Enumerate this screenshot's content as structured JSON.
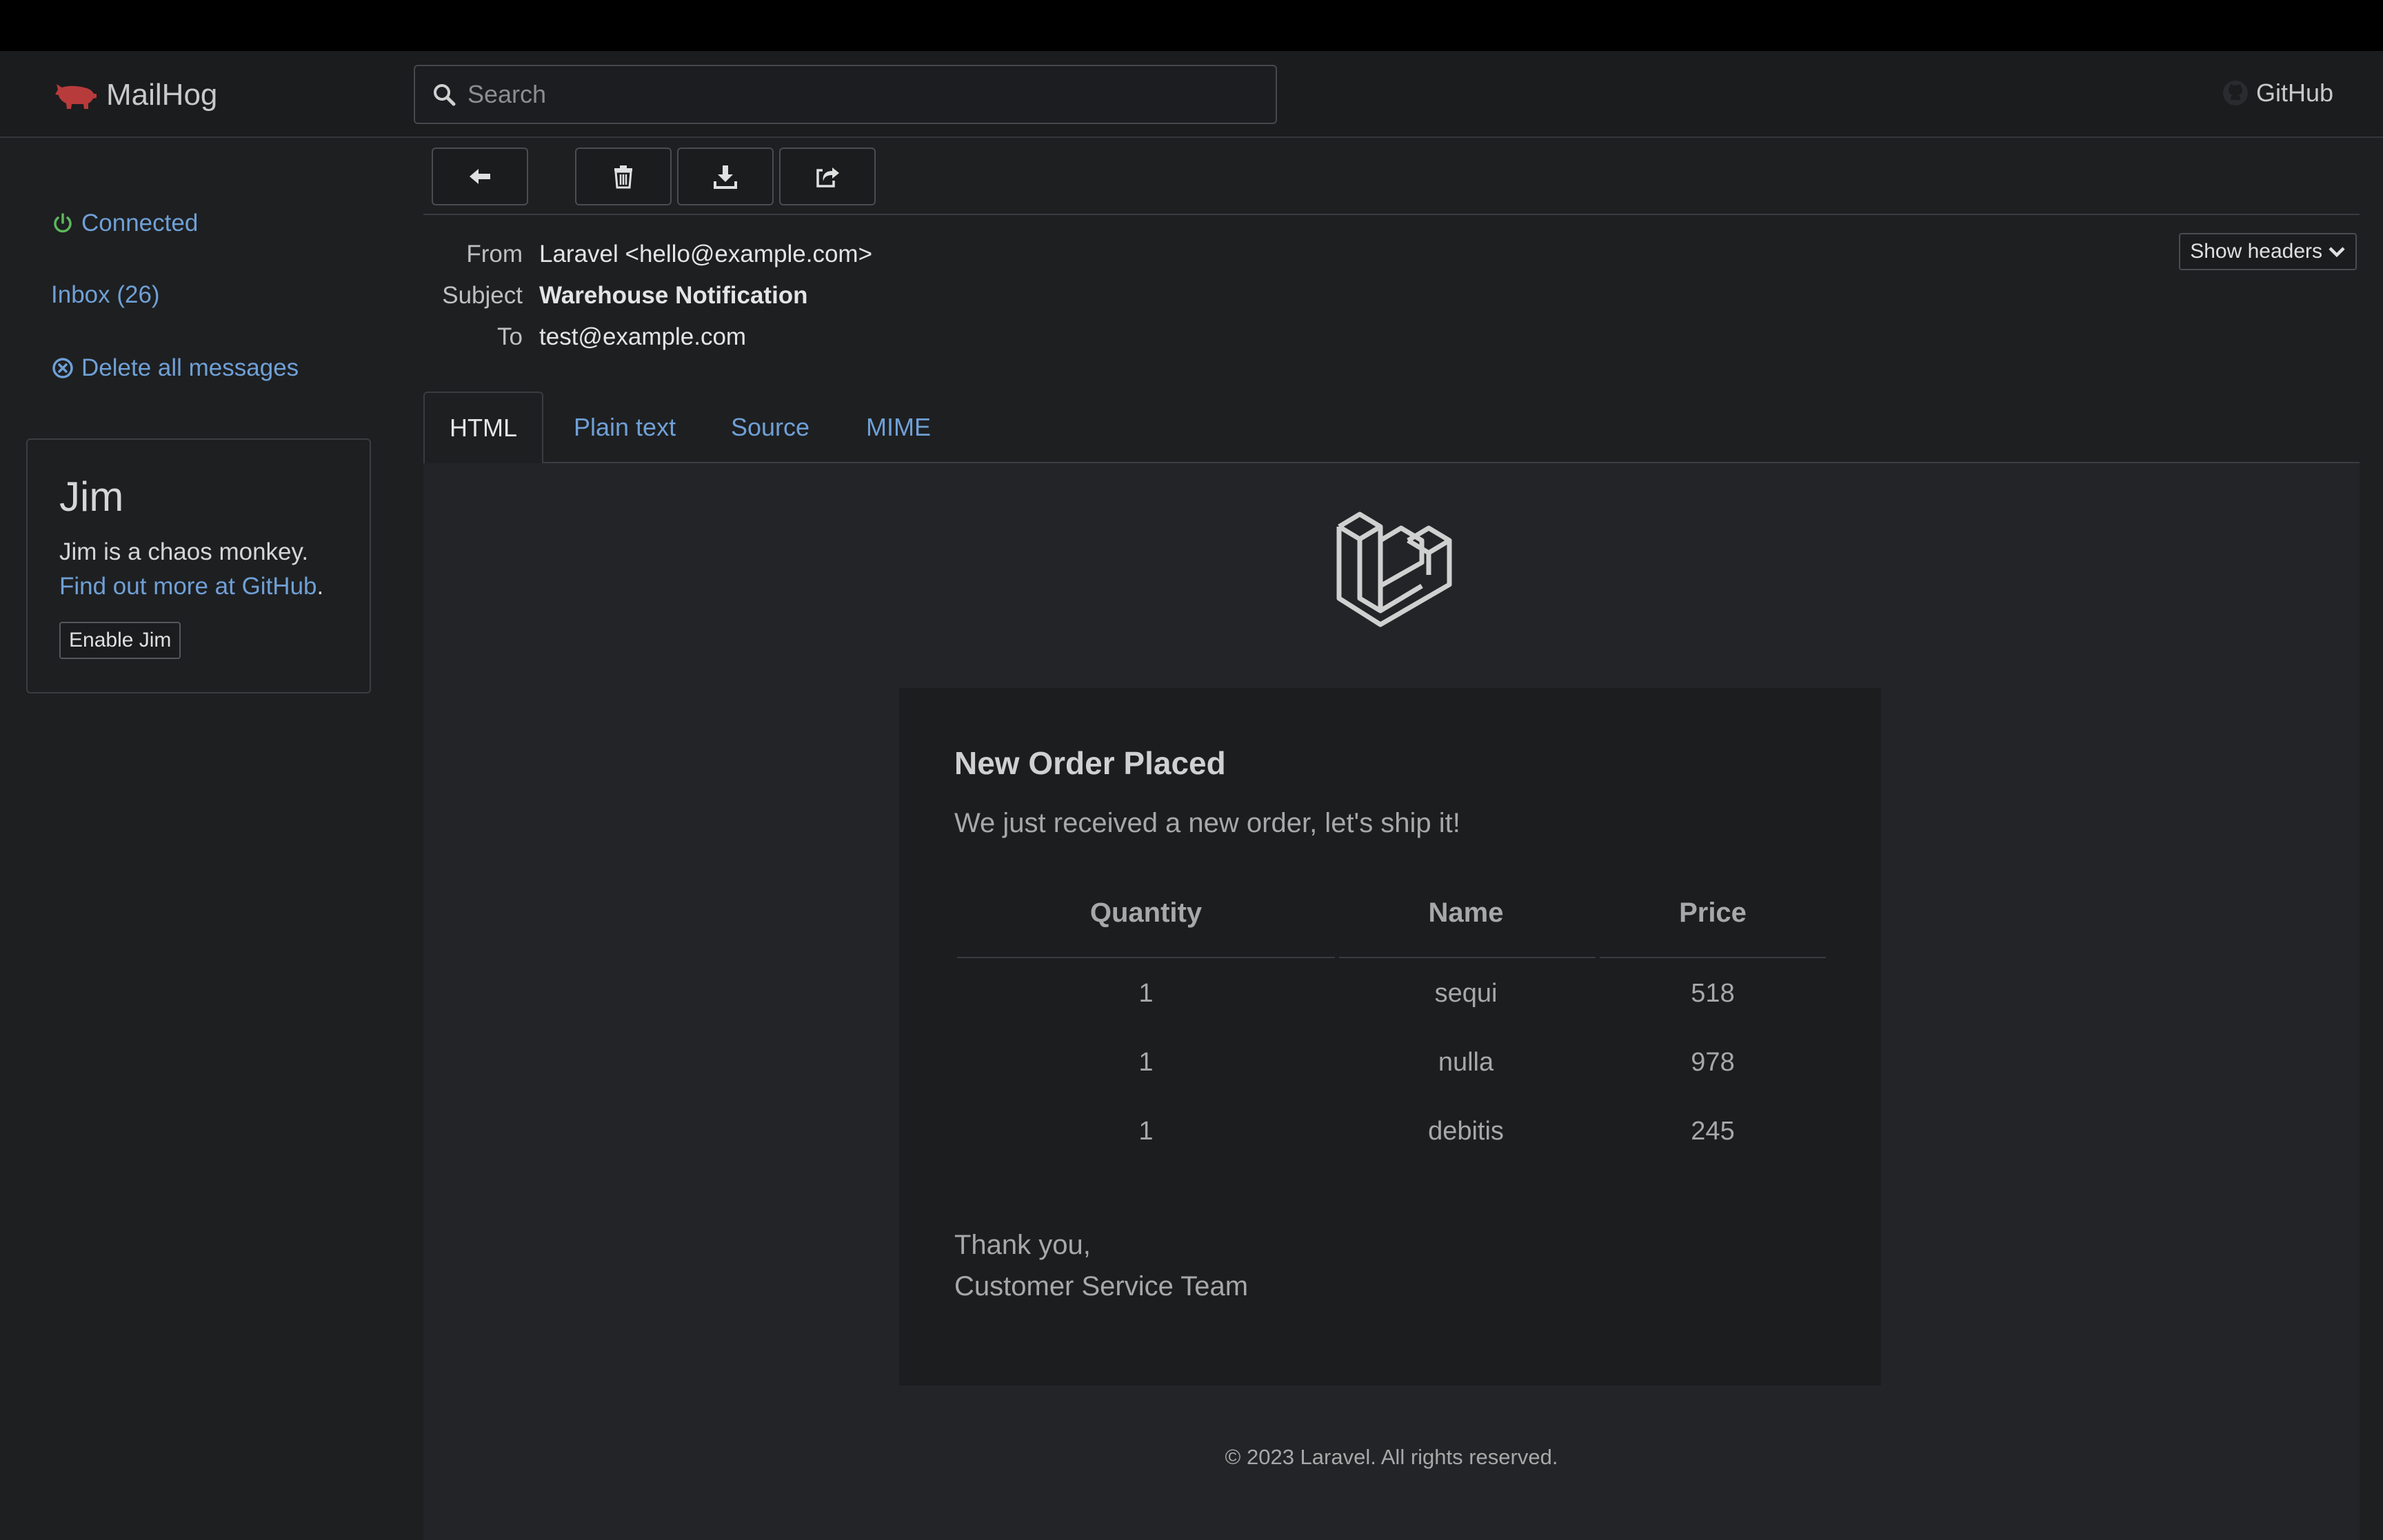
{
  "app": {
    "brand": "MailHog",
    "github": "GitHub"
  },
  "search": {
    "placeholder": "Search",
    "value": ""
  },
  "sidebar": {
    "connected": "Connected",
    "inbox": "Inbox (26)",
    "delete_all": "Delete all messages",
    "jim": {
      "title": "Jim",
      "desc_text": "Jim is a chaos monkey.",
      "link_text": "Find out more at GitHub",
      "period": ".",
      "button": "Enable Jim"
    }
  },
  "toolbar": {
    "back_icon": "arrow-left-icon",
    "delete_icon": "trash-icon",
    "download_icon": "download-icon",
    "release_icon": "share-icon"
  },
  "message": {
    "from_label": "From",
    "from": "Laravel <hello@example.com>",
    "subject_label": "Subject",
    "subject": "Warehouse Notification",
    "to_label": "To",
    "to": "test@example.com",
    "show_headers": "Show headers"
  },
  "tabs": [
    {
      "label": "HTML",
      "active": true
    },
    {
      "label": "Plain text",
      "active": false
    },
    {
      "label": "Source",
      "active": false
    },
    {
      "label": "MIME",
      "active": false
    }
  ],
  "email": {
    "title": "New Order Placed",
    "subtitle": "We just received a new order, let's ship it!",
    "table": {
      "headers": [
        "Quantity",
        "Name",
        "Price"
      ],
      "rows": [
        [
          "1",
          "sequi",
          "518"
        ],
        [
          "1",
          "nulla",
          "978"
        ],
        [
          "1",
          "debitis",
          "245"
        ]
      ]
    },
    "thanks_line1": "Thank you,",
    "thanks_line2": "Customer Service Team",
    "footer": "© 2023 Laravel. All rights reserved."
  },
  "colors": {
    "link": "#6fa0d6",
    "connected": "#5cb85c",
    "brand_icon": "#b83b3b"
  }
}
